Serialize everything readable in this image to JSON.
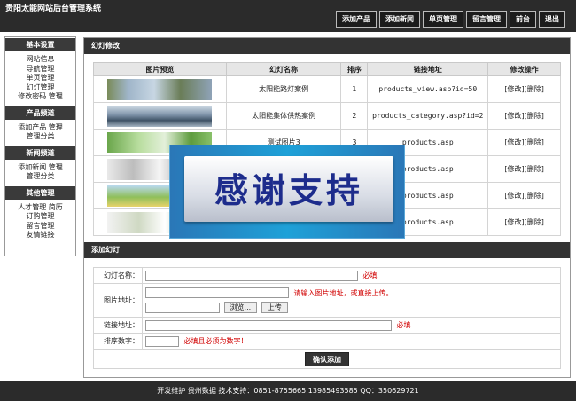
{
  "header": {
    "title": "贵阳太能网站后台管理系统",
    "nav": [
      "添加产品",
      "添加新闻",
      "单页管理",
      "留言管理",
      "前台",
      "退出"
    ]
  },
  "sidebar": {
    "sections": [
      {
        "title": "基本设置",
        "items": [
          "网站信息",
          "导航管理",
          "单页管理",
          "幻灯管理",
          "修改密码 管理"
        ]
      },
      {
        "title": "产品频道",
        "items": [
          "添加产品 管理",
          "管理分类"
        ]
      },
      {
        "title": "新闻频道",
        "items": [
          "添加新闻 管理",
          "管理分类"
        ]
      },
      {
        "title": "其他管理",
        "items": [
          "人才管理 简历",
          "订购管理",
          "留言管理",
          "友情链接"
        ]
      }
    ]
  },
  "slides": {
    "title": "幻灯修改",
    "headers": [
      "图片预览",
      "幻灯名称",
      "排序",
      "链接地址",
      "修改操作"
    ],
    "rows": [
      {
        "name": "太阳能路灯案例",
        "order": "1",
        "link": "products_view.asp?id=50",
        "edit": "[修改]",
        "del": "[删除]"
      },
      {
        "name": "太阳能集体供热案例",
        "order": "2",
        "link": "products_category.asp?id=2",
        "edit": "[修改]",
        "del": "[删除]"
      },
      {
        "name": "测试图片3",
        "order": "3",
        "link": "products.asp",
        "edit": "[修改]",
        "del": "[删除]"
      },
      {
        "name": "",
        "order": "",
        "link": "products.asp",
        "edit": "[修改]",
        "del": "[删除]"
      },
      {
        "name": "",
        "order": "",
        "link": "products.asp",
        "edit": "[修改]",
        "del": "[删除]"
      },
      {
        "name": "",
        "order": "",
        "link": "products.asp",
        "edit": "[修改]",
        "del": "[删除]"
      }
    ]
  },
  "add_form": {
    "title": "添加幻灯",
    "name_label": "幻灯名称：",
    "name_hint": "必填",
    "image_label": "图片地址：",
    "image_hint": "请输入图片地址，或直接上传。",
    "browse_label": "浏览...",
    "upload_label": "上传",
    "link_label": "链接地址：",
    "link_hint": "必填",
    "order_label": "排序数字：",
    "order_hint": "必填且必须为数字！",
    "submit_label": "确认添加"
  },
  "overlay": {
    "text": "感谢支持"
  },
  "footer": {
    "text": "开发维护 贵州数据 技术支持：0851-8755665 13985493585 QQ：350629721"
  }
}
